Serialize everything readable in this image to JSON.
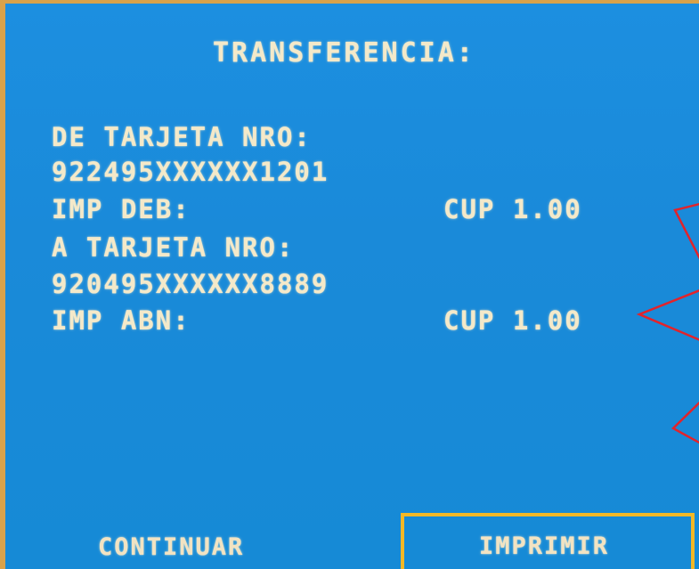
{
  "screen": {
    "title": "TRANSFERENCIA:",
    "from_card_label": "DE TARJETA NRO:",
    "from_card_number": "922495XXXXXX1201",
    "debit_label": "IMP DEB:",
    "debit_amount": "CUP 1.00",
    "to_card_label": "A TARJETA NRO:",
    "to_card_number": "920495XXXXXX8889",
    "credit_label": "IMP ABN:",
    "credit_amount": "CUP 1.00"
  },
  "buttons": {
    "continue_label": "CONTINUAR",
    "print_label": "IMPRIMIR"
  },
  "colors": {
    "screen_background": "#1a8ad9",
    "text": "#f4e9c9",
    "highlight_frame": "#f3b826",
    "annotation_arrows": "#e2232b"
  },
  "annotations": {
    "arrows": "red arrow outlines pointing left at the amounts",
    "highlight": "yellow frame around print button"
  }
}
